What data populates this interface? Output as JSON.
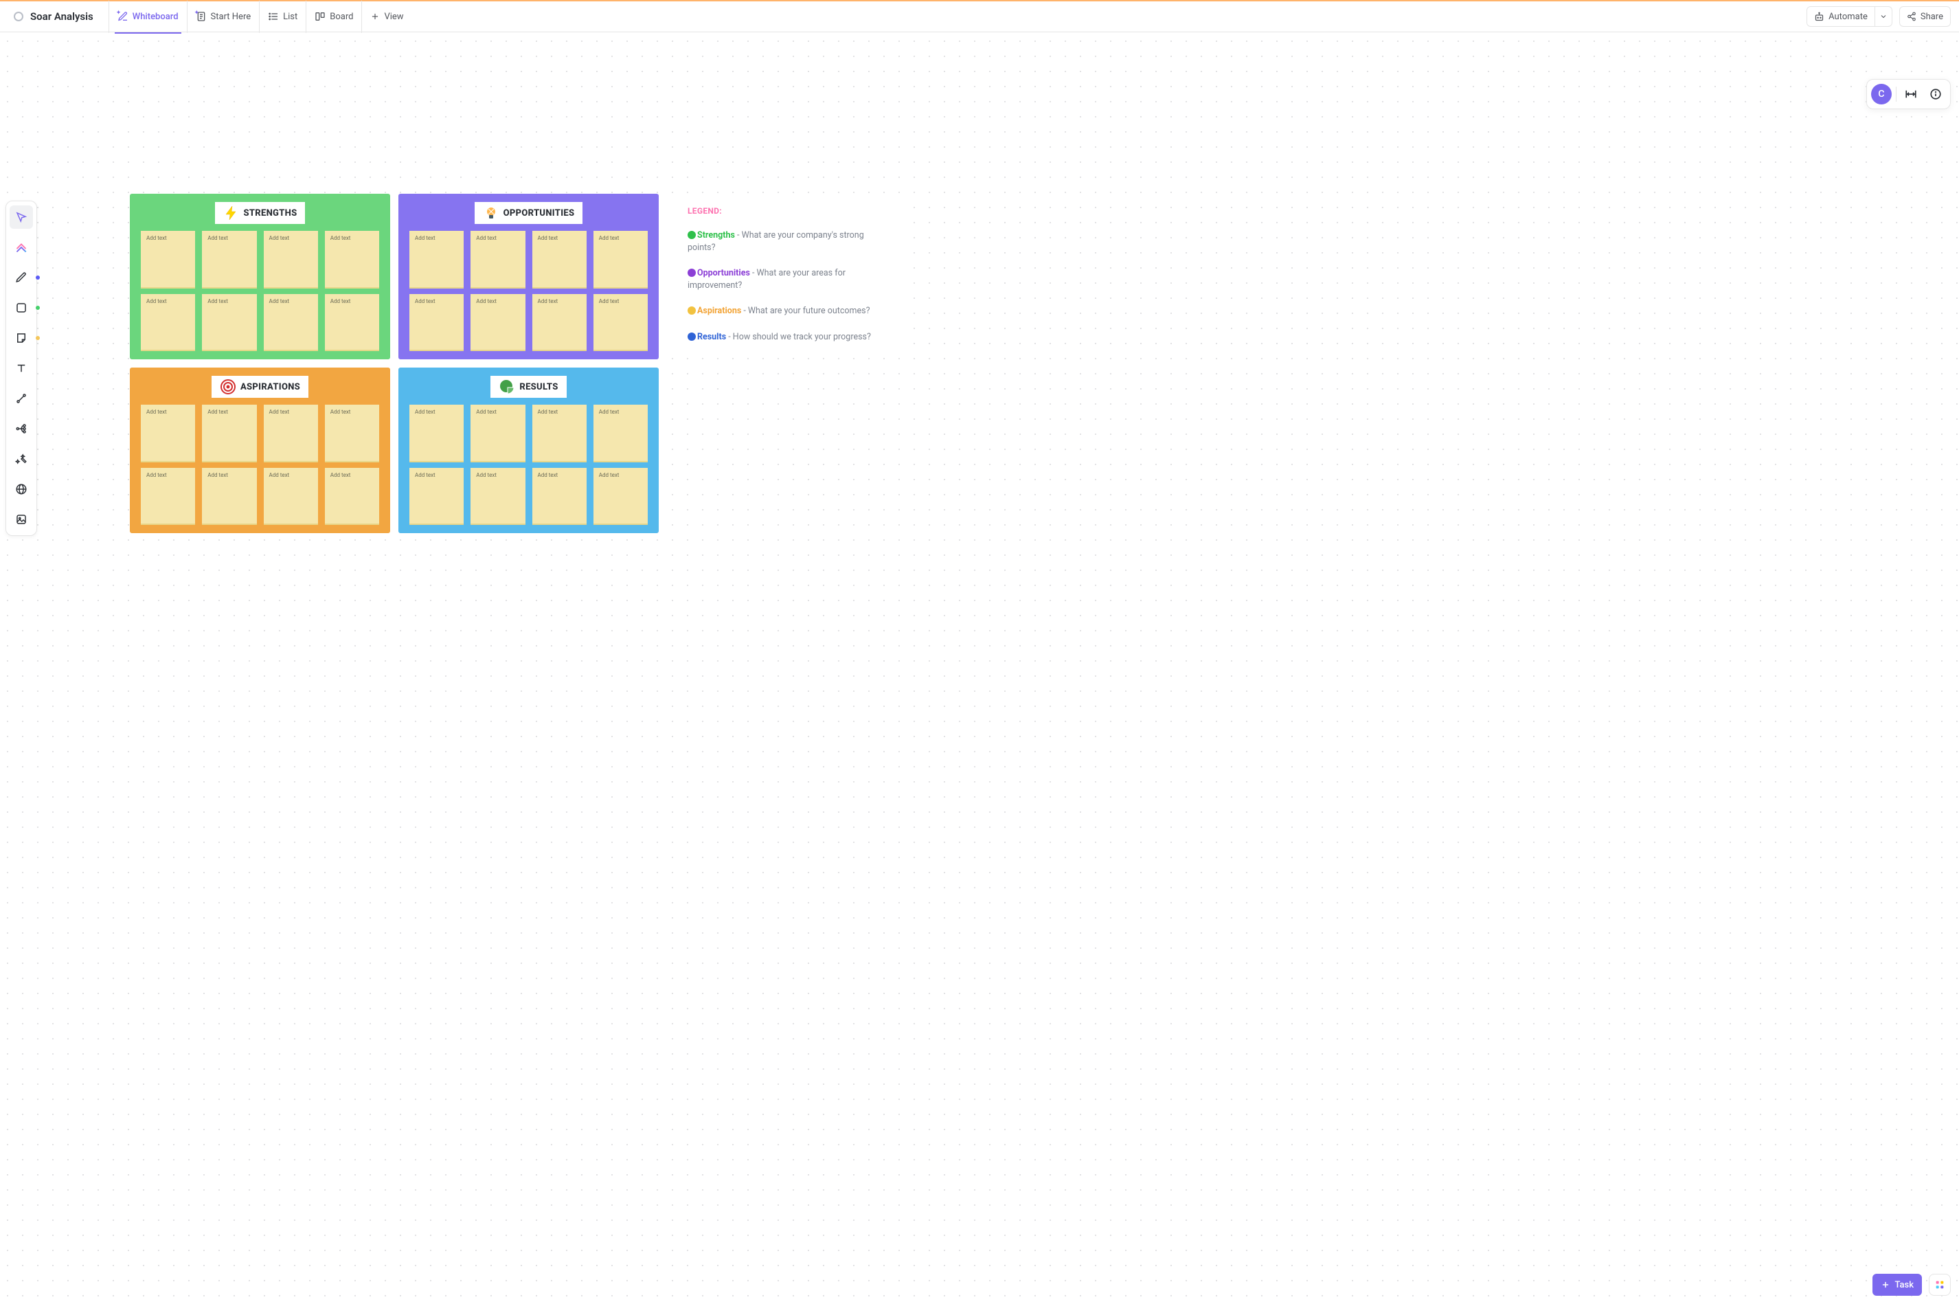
{
  "header": {
    "title": "Soar Analysis",
    "tabs": [
      {
        "label": "Whiteboard",
        "active": true
      },
      {
        "label": "Start Here",
        "active": false
      },
      {
        "label": "List",
        "active": false
      },
      {
        "label": "Board",
        "active": false
      }
    ],
    "add_view_label": "View",
    "automate_label": "Automate",
    "share_label": "Share"
  },
  "avatar_initial": "C",
  "task_button_label": "Task",
  "quadrants": [
    {
      "id": "strengths",
      "title": "STRENGTHS",
      "bg": "#6bd67d",
      "icon": "bolt"
    },
    {
      "id": "opportunities",
      "title": "OPPORTUNITIES",
      "bg": "#8674f0",
      "icon": "bulb"
    },
    {
      "id": "aspirations",
      "title": "ASPIRATIONS",
      "bg": "#f2a641",
      "icon": "target"
    },
    {
      "id": "results",
      "title": "RESULTS",
      "bg": "#55b9ec",
      "icon": "pie"
    }
  ],
  "note_placeholder": "Add text",
  "notes_per_quadrant": 8,
  "legend": {
    "title": "LEGEND:",
    "items": [
      {
        "dot": "#2ec04a",
        "label": "Strengths",
        "label_color": "#2ec04a",
        "suffix": " - ",
        "desc": "What are your company's strong points?"
      },
      {
        "dot": "#8c3fd6",
        "label": "Opportunities",
        "label_color": "#8c3fd6",
        "suffix": " - ",
        "desc": "What are your areas for improvement?"
      },
      {
        "dot": "#f2c23f",
        "label": "Aspirations",
        "label_color": "#f2a335",
        "suffix": " - ",
        "desc": "What are your future outcomes?"
      },
      {
        "dot": "#2f63d6",
        "label": "Results",
        "label_color": "#2f63d6",
        "suffix": " - ",
        "desc": "How should we track your progress?"
      }
    ]
  },
  "tool_colors": {
    "pen": "#5b5bf5",
    "shape": "#45d06b",
    "sticky": "#f4c65a"
  }
}
